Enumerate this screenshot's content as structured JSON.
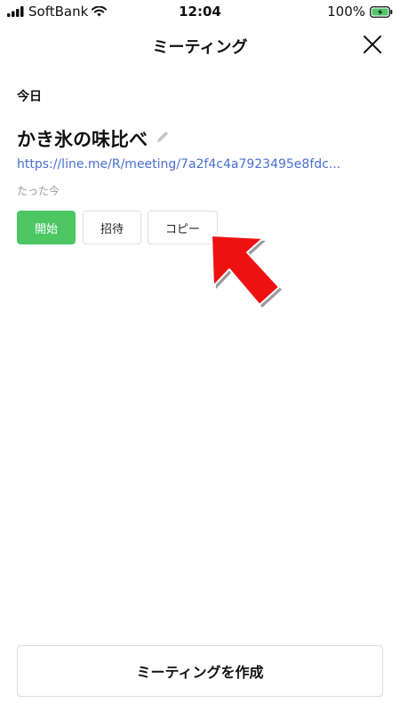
{
  "status_bar": {
    "carrier": "SoftBank",
    "time": "12:04",
    "battery_percent": "100%",
    "icons": [
      "signal-bars-icon",
      "wifi-icon",
      "battery-charging-icon"
    ]
  },
  "header": {
    "title": "ミーティング",
    "close_icon": "close-icon"
  },
  "section": {
    "title": "今日"
  },
  "meeting": {
    "name": "かき氷の味比べ",
    "edit_icon": "pencil-icon",
    "link": "https://line.me/R/meeting/7a2f4c4a7923495e8fdc...",
    "time": "たった今"
  },
  "actions": {
    "start_label": "開始",
    "invite_label": "招待",
    "copy_label": "コピー"
  },
  "footer": {
    "create_label": "ミーティングを作成"
  },
  "colors": {
    "accent_green": "#4cc764",
    "link_blue": "#4a6fd0",
    "arrow_red": "#ee1111"
  }
}
